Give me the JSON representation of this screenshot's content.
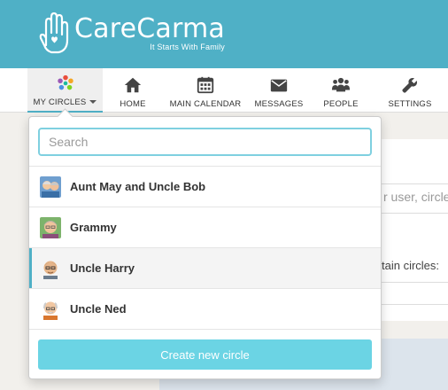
{
  "brand": {
    "name": "CareCarma",
    "tagline": "It Starts With Family"
  },
  "nav": {
    "my_circles": "MY CIRCLES",
    "home": "HOME",
    "calendar": "MAIN CALENDAR",
    "messages": "MESSAGES",
    "people": "PEOPLE",
    "settings": "SETTINGS"
  },
  "dropdown": {
    "search_placeholder": "Search",
    "circles": [
      {
        "label": "Aunt May and Uncle Bob",
        "avatar": "elderly-couple-avatar"
      },
      {
        "label": "Grammy",
        "avatar": "grandma-avatar"
      },
      {
        "label": "Uncle Harry",
        "avatar": "uncle-harry-avatar",
        "selected": true
      },
      {
        "label": "Uncle Ned",
        "avatar": "uncle-ned-avatar"
      }
    ],
    "create_label": "Create new circle"
  },
  "background": {
    "text_1": "r user, circle",
    "text_2": "tain circles:"
  },
  "colors": {
    "header": "#4fb0c6",
    "button": "#6bd4e4",
    "focus": "#7fd0e0"
  }
}
